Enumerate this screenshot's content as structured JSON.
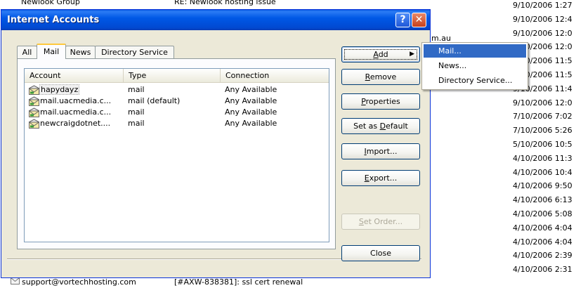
{
  "background_list": {
    "top_row": {
      "sender": "Newlook Group",
      "subject": "RE: Newlook hosting issue"
    },
    "snippet": "m.au",
    "bottom_row": {
      "sender": "support@vortechhosting.com",
      "subject": "[#AXW-838381]: ssl cert renewal"
    },
    "dates": [
      "9/10/2006 1:27",
      "9/10/2006 12:4",
      "9/10/2006 12:0",
      "9/10/2006 12:0",
      "9/10/2006 11:5",
      "9/10/2006 11:5",
      "9/10/2006 11:4",
      "9/10/2006 12:0",
      "7/10/2006 7:02",
      "7/10/2006 5:26",
      "5/10/2006 10:5",
      "4/10/2006 11:3",
      "4/10/2006 10:4",
      "4/10/2006 9:50",
      "4/10/2006 6:13",
      "4/10/2006 5:08",
      "4/10/2006 4:04",
      "4/10/2006 4:04",
      "4/10/2006 2:39",
      "4/10/2006 2:31"
    ]
  },
  "dialog": {
    "title": "Internet Accounts",
    "help_glyph": "?",
    "close_glyph": "✕",
    "tabs": [
      {
        "label": "All"
      },
      {
        "label": "Mail"
      },
      {
        "label": "News"
      },
      {
        "label": "Directory Service"
      }
    ],
    "active_tab": "Mail",
    "columns": [
      "Account",
      "Type",
      "Connection"
    ],
    "accounts": [
      {
        "name": "hapydayz",
        "type": "mail",
        "connection": "Any Available"
      },
      {
        "name": "mail.uacmedia.c...",
        "type": "mail (default)",
        "connection": "Any Available"
      },
      {
        "name": "mail.uacmedia.c...",
        "type": "mail",
        "connection": "Any Available"
      },
      {
        "name": "newcraigdotnet....",
        "type": "mail",
        "connection": "Any Available"
      }
    ],
    "buttons": {
      "add": {
        "pre": "",
        "key": "A",
        "post": "dd",
        "arrow": "▶"
      },
      "remove": {
        "pre": "",
        "key": "R",
        "post": "emove"
      },
      "properties": {
        "pre": "",
        "key": "P",
        "post": "roperties"
      },
      "set_default": {
        "pre": "Set as ",
        "key": "D",
        "post": "efault"
      },
      "import": {
        "pre": "",
        "key": "I",
        "post": "mport..."
      },
      "export": {
        "pre": "",
        "key": "E",
        "post": "xport..."
      },
      "set_order": {
        "pre": "",
        "key": "S",
        "post": "et Order..."
      },
      "close": {
        "label": "Close"
      }
    }
  },
  "add_menu": {
    "items": [
      "Mail...",
      "News...",
      "Directory Service..."
    ],
    "highlighted": "Mail..."
  },
  "colors": {
    "titlebar": "#0058e6",
    "dialog_face": "#ece9d8",
    "menu_highlight": "#316ac5",
    "tab_accent": "#ffc83c"
  }
}
